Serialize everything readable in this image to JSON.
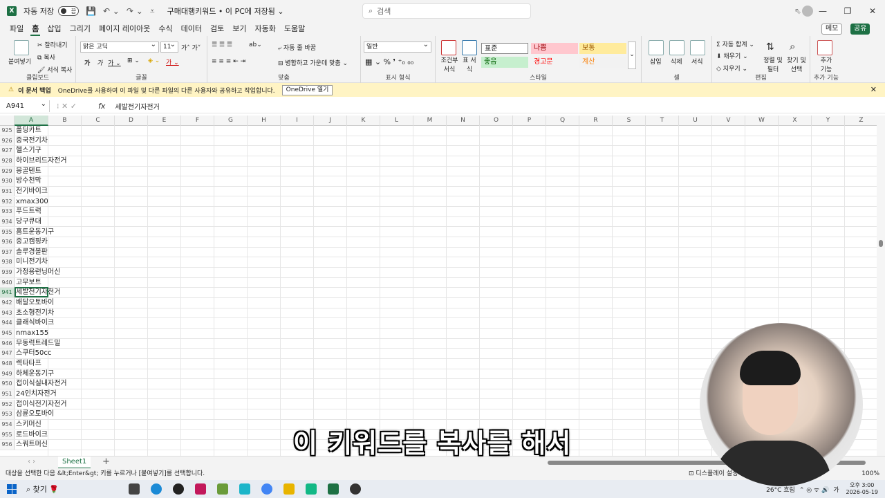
{
  "titlebar": {
    "autosave_label": "자동 저장",
    "autosave_state": "끔",
    "filename": "구매대행키워드 • 이 PC에 저장됨 ⌄",
    "search_placeholder": "검색"
  },
  "menu": [
    "파일",
    "홈",
    "삽입",
    "그리기",
    "페이지 레이아웃",
    "수식",
    "데이터",
    "검토",
    "보기",
    "자동화",
    "도움말"
  ],
  "menu_active": "홈",
  "memo_label": "메모",
  "share_label": "공유",
  "ribbon": {
    "clipboard": {
      "name": "클립보드",
      "paste": "붙여넣기",
      "cut": "잘라내기",
      "copy": "복사",
      "format_painter": "서식 복사"
    },
    "font": {
      "name": "글꼴",
      "family": "맑은 고딕",
      "size": "11"
    },
    "align": {
      "name": "맞춤",
      "wrap": "자동 줄 바꿈",
      "merge": "병합하고 가운데 맞춤"
    },
    "number": {
      "name": "표시 형식",
      "format": "일반"
    },
    "styles": {
      "name": "스타일",
      "cond": "조건부 서식",
      "table": "표 서식",
      "cells": [
        {
          "label": "표준",
          "bg": "#ffffff",
          "color": "#000000"
        },
        {
          "label": "나쁨",
          "bg": "#ffc7ce",
          "color": "#9c0006"
        },
        {
          "label": "보통",
          "bg": "#ffeb9c",
          "color": "#9c5700"
        },
        {
          "label": "좋음",
          "bg": "#c6efce",
          "color": "#006100"
        },
        {
          "label": "경고문",
          "bg": "#f3f3f3",
          "color": "#ff0000"
        },
        {
          "label": "계산",
          "bg": "#f2f2f2",
          "color": "#fa7d00"
        }
      ]
    },
    "cells": {
      "name": "셀",
      "insert": "삽입",
      "delete": "삭제",
      "format": "서식"
    },
    "editing": {
      "name": "편집",
      "autosum": "자동 합계",
      "fill": "채우기",
      "clear": "지우기",
      "sort": "정렬 및 필터",
      "find": "찾기 및 선택"
    },
    "addins": {
      "name": "추가 기능",
      "label": "추가 기능"
    }
  },
  "infobar": {
    "title": "이 문서 백업",
    "message": "OneDrive를 사용하여 이 파일 및 다른 파일의 다른 사용자와 공유하고 작업합니다.",
    "button": "OneDrive 열기"
  },
  "formula": {
    "cell": "A941",
    "fx": "fx",
    "content": "세발전기자전거"
  },
  "columns": [
    "A",
    "B",
    "C",
    "D",
    "E",
    "F",
    "G",
    "H",
    "I",
    "J",
    "K",
    "L",
    "M",
    "N",
    "O",
    "P",
    "Q",
    "R",
    "S",
    "T",
    "U",
    "V",
    "W",
    "X",
    "Y",
    "Z"
  ],
  "rows": [
    {
      "n": "925",
      "v": "폴딩카트"
    },
    {
      "n": "926",
      "v": "중국전기차"
    },
    {
      "n": "927",
      "v": "헬스기구"
    },
    {
      "n": "928",
      "v": "하이브리드자전거"
    },
    {
      "n": "929",
      "v": "몽골텐트"
    },
    {
      "n": "930",
      "v": "방수천막"
    },
    {
      "n": "931",
      "v": "전기바이크"
    },
    {
      "n": "932",
      "v": "xmax300"
    },
    {
      "n": "933",
      "v": "푸드트럭"
    },
    {
      "n": "934",
      "v": "당구큐대"
    },
    {
      "n": "935",
      "v": "홈트운동기구"
    },
    {
      "n": "936",
      "v": "중고캠핑카"
    },
    {
      "n": "937",
      "v": "솔루경볼판"
    },
    {
      "n": "938",
      "v": "미니전기차"
    },
    {
      "n": "939",
      "v": "가정용런닝머신"
    },
    {
      "n": "940",
      "v": "고무보트"
    },
    {
      "n": "941",
      "v": "세발전기자전거"
    },
    {
      "n": "942",
      "v": "배달오토바이"
    },
    {
      "n": "943",
      "v": "초소형전기차"
    },
    {
      "n": "944",
      "v": "클래식바이크"
    },
    {
      "n": "945",
      "v": "nmax155"
    },
    {
      "n": "946",
      "v": "무동력트레드밀"
    },
    {
      "n": "947",
      "v": "스쿠터50cc"
    },
    {
      "n": "948",
      "v": "렉타타프"
    },
    {
      "n": "949",
      "v": "하체운동기구"
    },
    {
      "n": "950",
      "v": "접이식실내자전거"
    },
    {
      "n": "951",
      "v": "24인치자전거"
    },
    {
      "n": "952",
      "v": "접이식전기자전거"
    },
    {
      "n": "953",
      "v": "삼륜오토바이"
    },
    {
      "n": "954",
      "v": "스키머신"
    },
    {
      "n": "955",
      "v": "로드바이크"
    },
    {
      "n": "956",
      "v": "스쿼트머신"
    }
  ],
  "sheet_tab": "Sheet1",
  "status": {
    "message": "대상을 선택한 다음 &lt;Enter&gt; 키를 누르거나 [붙여넣기]를 선택합니다.",
    "display": "디스플레이 설정",
    "zoom": "100%"
  },
  "taskbar": {
    "search": "찾기",
    "weather": "26°C 흐림",
    "time": "오후 3:00",
    "date": "2026-05-19",
    "lang": "가"
  },
  "subtitle": "이 키워드를 복사를 해서"
}
